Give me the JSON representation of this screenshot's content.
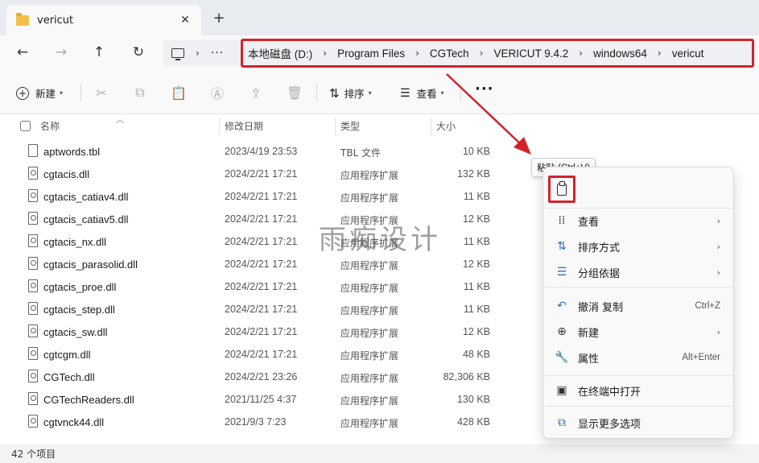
{
  "titlebar": {
    "tab_title": "vericut",
    "close_glyph": "✕",
    "new_tab_glyph": "+"
  },
  "nav": {
    "back": "←",
    "forward": "→",
    "up": "↑",
    "refresh": "↻"
  },
  "address": {
    "lead_sep": "›",
    "dots": "···",
    "crumbs": [
      "本地磁盘 (D:)",
      "Program Files",
      "CGTech",
      "VERICUT 9.4.2",
      "windows64",
      "vericut"
    ],
    "crumb_sep": "›"
  },
  "toolbar": {
    "new_label": "新建",
    "sort_label": "排序",
    "view_label": "查看",
    "more": "···"
  },
  "columns": {
    "name": "名称",
    "date": "修改日期",
    "type": "类型",
    "size": "大小"
  },
  "files": [
    {
      "name": "aptwords.tbl",
      "date": "2023/4/19 23:53",
      "type": "TBL 文件",
      "size": "10 KB",
      "icon": "file-icon"
    },
    {
      "name": "cgtacis.dll",
      "date": "2024/2/21 17:21",
      "type": "应用程序扩展",
      "size": "132 KB",
      "icon": "dll-icon"
    },
    {
      "name": "cgtacis_catiav4.dll",
      "date": "2024/2/21 17:21",
      "type": "应用程序扩展",
      "size": "11 KB",
      "icon": "dll-icon"
    },
    {
      "name": "cgtacis_catiav5.dll",
      "date": "2024/2/21 17:21",
      "type": "应用程序扩展",
      "size": "12 KB",
      "icon": "dll-icon"
    },
    {
      "name": "cgtacis_nx.dll",
      "date": "2024/2/21 17:21",
      "type": "应用程序扩展",
      "size": "11 KB",
      "icon": "dll-icon"
    },
    {
      "name": "cgtacis_parasolid.dll",
      "date": "2024/2/21 17:21",
      "type": "应用程序扩展",
      "size": "12 KB",
      "icon": "dll-icon"
    },
    {
      "name": "cgtacis_proe.dll",
      "date": "2024/2/21 17:21",
      "type": "应用程序扩展",
      "size": "11 KB",
      "icon": "dll-icon"
    },
    {
      "name": "cgtacis_step.dll",
      "date": "2024/2/21 17:21",
      "type": "应用程序扩展",
      "size": "11 KB",
      "icon": "dll-icon"
    },
    {
      "name": "cgtacis_sw.dll",
      "date": "2024/2/21 17:21",
      "type": "应用程序扩展",
      "size": "12 KB",
      "icon": "dll-icon"
    },
    {
      "name": "cgtcgm.dll",
      "date": "2024/2/21 17:21",
      "type": "应用程序扩展",
      "size": "48 KB",
      "icon": "dll-icon"
    },
    {
      "name": "CGTech.dll",
      "date": "2024/2/21 23:26",
      "type": "应用程序扩展",
      "size": "82,306 KB",
      "icon": "dll-icon"
    },
    {
      "name": "CGTechReaders.dll",
      "date": "2021/11/25 4:37",
      "type": "应用程序扩展",
      "size": "130 KB",
      "icon": "dll-icon"
    },
    {
      "name": "cgtvnck44.dll",
      "date": "2021/9/3 7:23",
      "type": "应用程序扩展",
      "size": "428 KB",
      "icon": "dll-icon"
    }
  ],
  "watermark": "雨痴设计",
  "status": {
    "item_count": "42 个项目"
  },
  "tooltip": {
    "text": "粘贴 (Ctrl+V)"
  },
  "context_menu": {
    "items": [
      {
        "label": "查看",
        "icon": "grid-icon",
        "glyph": "⁞⁞",
        "shortcut": "",
        "arrow": "›"
      },
      {
        "label": "排序方式",
        "icon": "sort-icon",
        "glyph": "⇅",
        "shortcut": "",
        "arrow": "›"
      },
      {
        "label": "分组依据",
        "icon": "group-icon",
        "glyph": "☰",
        "shortcut": "",
        "arrow": "›"
      },
      {
        "label": "撤消 复制",
        "icon": "undo-icon",
        "glyph": "↶",
        "shortcut": "Ctrl+Z",
        "arrow": ""
      },
      {
        "label": "新建",
        "icon": "new-icon",
        "glyph": "⊕",
        "shortcut": "",
        "arrow": "›"
      },
      {
        "label": "属性",
        "icon": "wrench-icon",
        "glyph": "🔧",
        "shortcut": "Alt+Enter",
        "arrow": ""
      },
      {
        "label": "在终端中打开",
        "icon": "terminal-icon",
        "glyph": "▣",
        "shortcut": "",
        "arrow": ""
      },
      {
        "label": "显示更多选项",
        "icon": "more-options-icon",
        "glyph": "⧉",
        "shortcut": "",
        "arrow": ""
      }
    ]
  },
  "colors": {
    "highlight_red": "#d2232a",
    "accent_blue": "#2a6fc9"
  }
}
